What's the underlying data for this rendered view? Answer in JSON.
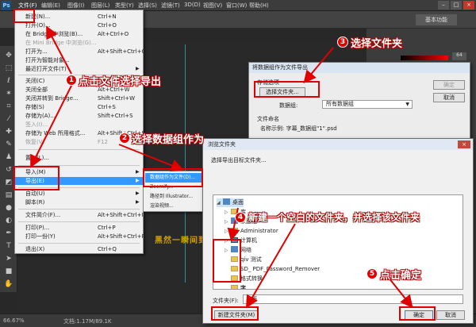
{
  "menubar": {
    "logo": "Ps",
    "items": [
      "文件(F)",
      "编辑(E)",
      "图像(I)",
      "图层(L)",
      "类型(Y)",
      "选择(S)",
      "滤镜(T)",
      "3D(D)",
      "视图(V)",
      "窗口(W)",
      "帮助(H)"
    ],
    "window_buttons": [
      "–",
      "□",
      "×"
    ]
  },
  "optionsbar": {
    "workspace": "基本功能"
  },
  "color_panel": {
    "value": "64"
  },
  "file_menu": {
    "items": [
      {
        "label": "新建(N)...",
        "shortcut": "Ctrl+N"
      },
      {
        "label": "打开(O)...",
        "shortcut": "Ctrl+O"
      },
      {
        "label": "在 Bridge 中浏览(B)...",
        "shortcut": "Alt+Ctrl+O"
      },
      {
        "label": "在 Mini Bridge 中浏览(G)...",
        "shortcut": "",
        "disabled": true
      },
      {
        "label": "打开为...",
        "shortcut": "Alt+Shift+Ctrl+O"
      },
      {
        "label": "打开为智能对象...",
        "shortcut": ""
      },
      {
        "label": "最近打开文件(T)",
        "shortcut": "",
        "submenu": true
      },
      {
        "label": "关闭(C)",
        "shortcut": "Ctrl+W"
      },
      {
        "label": "关闭全部",
        "shortcut": "Alt+Ctrl+W"
      },
      {
        "label": "关闭并转到 Bridge...",
        "shortcut": "Shift+Ctrl+W"
      },
      {
        "label": "存储(S)",
        "shortcut": "Ctrl+S"
      },
      {
        "label": "存储为(A)...",
        "shortcut": "Shift+Ctrl+S"
      },
      {
        "label": "签入(I)...",
        "shortcut": "",
        "disabled": true
      },
      {
        "label": "存储为 Web 所用格式...",
        "shortcut": "Alt+Shift+Ctrl+S"
      },
      {
        "label": "恢复(V)",
        "shortcut": "F12",
        "disabled": true
      },
      {
        "label": "置入(L)...",
        "shortcut": ""
      },
      {
        "label": "导入(M)",
        "shortcut": "",
        "submenu": true
      },
      {
        "label": "导出(E)",
        "shortcut": "",
        "submenu": true,
        "highlight": true
      },
      {
        "label": "自动(U)",
        "shortcut": "",
        "submenu": true
      },
      {
        "label": "脚本(R)",
        "shortcut": "",
        "submenu": true
      },
      {
        "label": "文件简介(F)...",
        "shortcut": "Alt+Shift+Ctrl+I"
      },
      {
        "label": "打印(P)...",
        "shortcut": "Ctrl+P"
      },
      {
        "label": "打印一份(Y)",
        "shortcut": "Alt+Shift+Ctrl+P"
      },
      {
        "label": "退出(X)",
        "shortcut": "Ctrl+Q"
      }
    ]
  },
  "export_submenu": {
    "items": [
      {
        "label": "数据组作为文件(D)...",
        "highlight": true
      },
      {
        "label": "Zoomify..."
      },
      {
        "label": "路径到 Illustrator..."
      },
      {
        "label": "渲染视频..."
      }
    ]
  },
  "export_dialog": {
    "title": "将数据组作为文件导出",
    "store_group": "存储选项",
    "select_folder_button": "选择文件夹...",
    "layer_label": "数据组:",
    "layer_value": "所有数据组",
    "name_group": "文件命名",
    "sample_name": "名称示例: 字幕_数据组\"1\".psd",
    "ok": "确定",
    "cancel": "取消"
  },
  "browse_dialog": {
    "title": "浏览文件夹",
    "prompt": "选择导出目标文件夹...",
    "close": "×",
    "tree": [
      {
        "label": "桌面",
        "level": 0,
        "icon": "desktop"
      },
      {
        "label": "库",
        "level": 1,
        "icon": "folder",
        "expander": "▷"
      },
      {
        "label": "家庭组",
        "level": 1,
        "icon": "homegroup",
        "expander": "▷"
      },
      {
        "label": "Administrator",
        "level": 1,
        "icon": "user",
        "expander": "▷"
      },
      {
        "label": "计算机",
        "level": 1,
        "icon": "computer",
        "expander": "▷"
      },
      {
        "label": "网络",
        "level": 1,
        "icon": "network",
        "expander": "▷"
      },
      {
        "label": "qiv 测试",
        "level": 1,
        "icon": "folder"
      },
      {
        "label": "SD_ PDF_Password_Remover",
        "level": 1,
        "icon": "folder"
      },
      {
        "label": "格式转换",
        "level": 1,
        "icon": "folder"
      },
      {
        "label": "字",
        "level": 1,
        "icon": "folder"
      }
    ],
    "folder_label": "文件夹(F):",
    "folder_value": "桌面",
    "new_folder_button": "新建文件夹(M)",
    "ok": "确定",
    "cancel": "取消"
  },
  "canvas": {
    "text": "黑然一瞬间到"
  },
  "statusbar": {
    "zoom": "66.67%",
    "doc": "文档:1.17M/89.1K"
  },
  "annotations": {
    "step1": "点击文件选择导出",
    "step2": "选择数据组作为",
    "step3": "选择文件夹",
    "step4": "新建一个空白的文件夹，并选择该文件夹",
    "step5": "点击确定",
    "numbers": [
      "1",
      "2",
      "3",
      "4",
      "5"
    ],
    "color": "#e00000"
  }
}
